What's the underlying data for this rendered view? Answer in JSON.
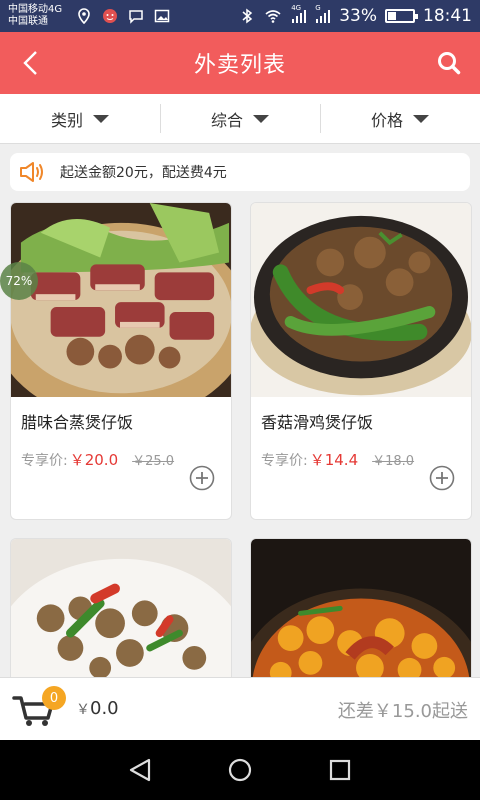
{
  "statusbar": {
    "carrier1": "中国移动4G",
    "carrier2": "中国联通",
    "signal1": "4G",
    "signal2": "G",
    "battery": "33%",
    "battery_level": 0.33,
    "time": "18:41"
  },
  "header": {
    "title": "外卖列表"
  },
  "filters": [
    {
      "label": "类别"
    },
    {
      "label": "综合"
    },
    {
      "label": "价格"
    }
  ],
  "notice": {
    "text": "起送金额20元，配送费4元"
  },
  "dishes": [
    {
      "name": "腊味合蒸煲仔饭",
      "price_label": "专享价:",
      "price": "￥20.0",
      "original_price": "￥25.0"
    },
    {
      "name": "香菇滑鸡煲仔饭",
      "price_label": "专享价:",
      "price": "￥14.4",
      "original_price": "￥18.0"
    },
    {
      "name": "",
      "price_label": "",
      "price": "",
      "original_price": ""
    },
    {
      "name": "",
      "price_label": "",
      "price": "",
      "original_price": ""
    }
  ],
  "overlay": {
    "progress": "72%"
  },
  "cart": {
    "count": "0",
    "currency": "￥",
    "total": "0.0",
    "remaining": "还差￥15.0起送"
  },
  "colors": {
    "header": "#f25c5c",
    "price": "#e53935",
    "badge": "#f5a623"
  }
}
